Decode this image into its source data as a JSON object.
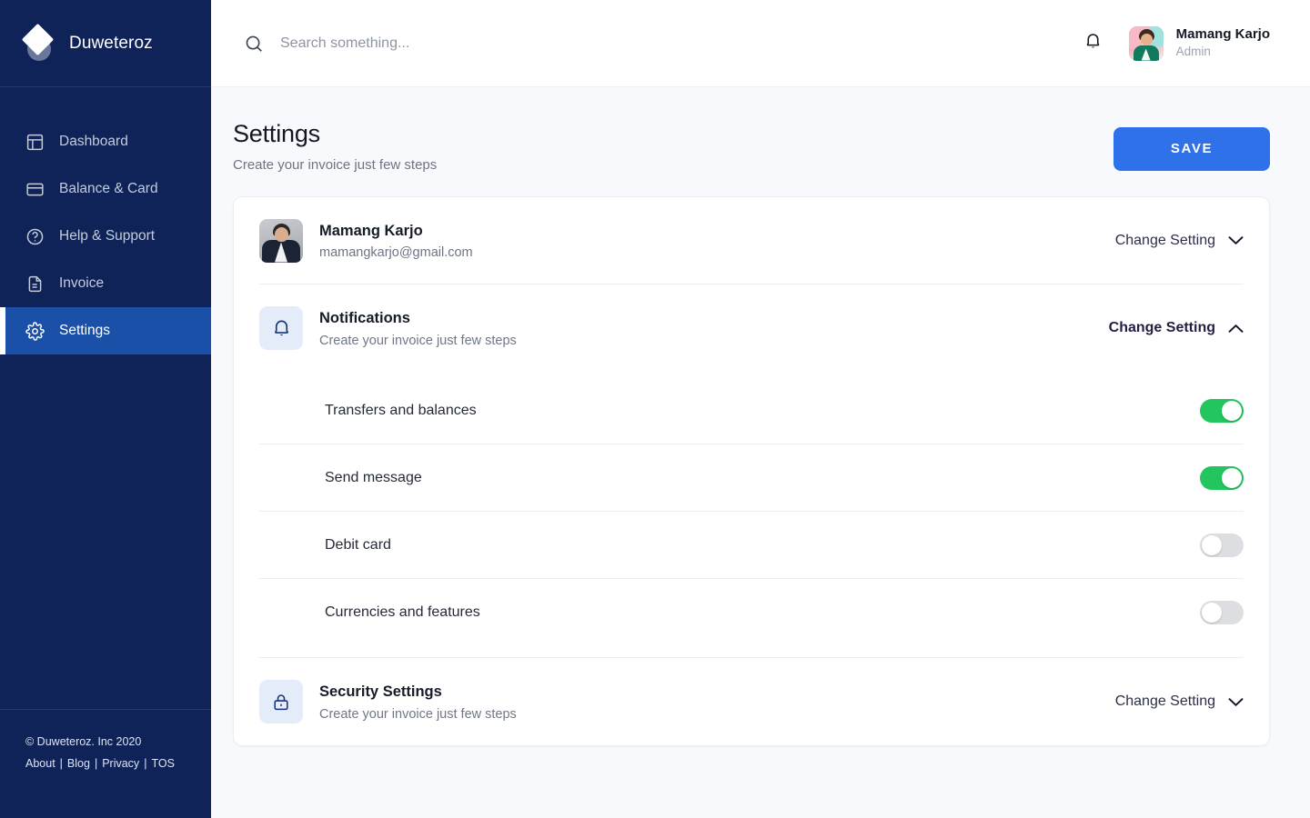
{
  "brand": {
    "name": "Duweteroz",
    "logo_icon": "diamond-logo-icon"
  },
  "sidebar": {
    "items": [
      {
        "label": "Dashboard",
        "icon": "dashboard-icon",
        "active": false
      },
      {
        "label": "Balance & Card",
        "icon": "card-icon",
        "active": false
      },
      {
        "label": "Help & Support",
        "icon": "help-circle-icon",
        "active": false
      },
      {
        "label": "Invoice",
        "icon": "document-icon",
        "active": false
      },
      {
        "label": "Settings",
        "icon": "gear-icon",
        "active": true
      }
    ],
    "footer": {
      "copyright": "© Duweteroz. Inc 2020",
      "links": [
        "About",
        "Blog",
        "Privacy",
        "TOS"
      ],
      "separator": "|"
    }
  },
  "topbar": {
    "search": {
      "placeholder": "Search something...",
      "value": "",
      "icon": "search-icon"
    },
    "notification_icon": "bell-icon",
    "user": {
      "name": "Mamang Karjo",
      "role": "Admin",
      "avatar": "user-photo-avatar"
    }
  },
  "page": {
    "title": "Settings",
    "subtitle": "Create your invoice just few steps",
    "save_label": "SAVE",
    "accent_color": "#2f71e8"
  },
  "settings": {
    "profile": {
      "name": "Mamang Karjo",
      "email": "mamangkarjo@gmail.com",
      "action_label": "Change Setting",
      "chevron": "chevron-down-icon",
      "avatar": "profile-photo-avatar"
    },
    "notifications": {
      "title": "Notifications",
      "subtitle": "Create your invoice just few steps",
      "icon": "bell-icon",
      "action_label": "Change Setting",
      "chevron": "chevron-up-icon",
      "expanded": true,
      "toggles": [
        {
          "label": "Transfers and balances",
          "on": true
        },
        {
          "label": "Send message",
          "on": true
        },
        {
          "label": "Debit card",
          "on": false
        },
        {
          "label": "Currencies and features",
          "on": false
        }
      ]
    },
    "security": {
      "title": "Security Settings",
      "subtitle": "Create your invoice just few steps",
      "icon": "lock-icon",
      "action_label": "Change Setting",
      "chevron": "chevron-down-icon"
    }
  },
  "colors": {
    "sidebar_bg": "#102358",
    "sidebar_active": "#1a50a8",
    "toggle_on": "#22c55e",
    "toggle_off": "#dcdee2",
    "icon_tile_bg": "#e5ecf9",
    "page_bg": "#f7f9fc"
  }
}
